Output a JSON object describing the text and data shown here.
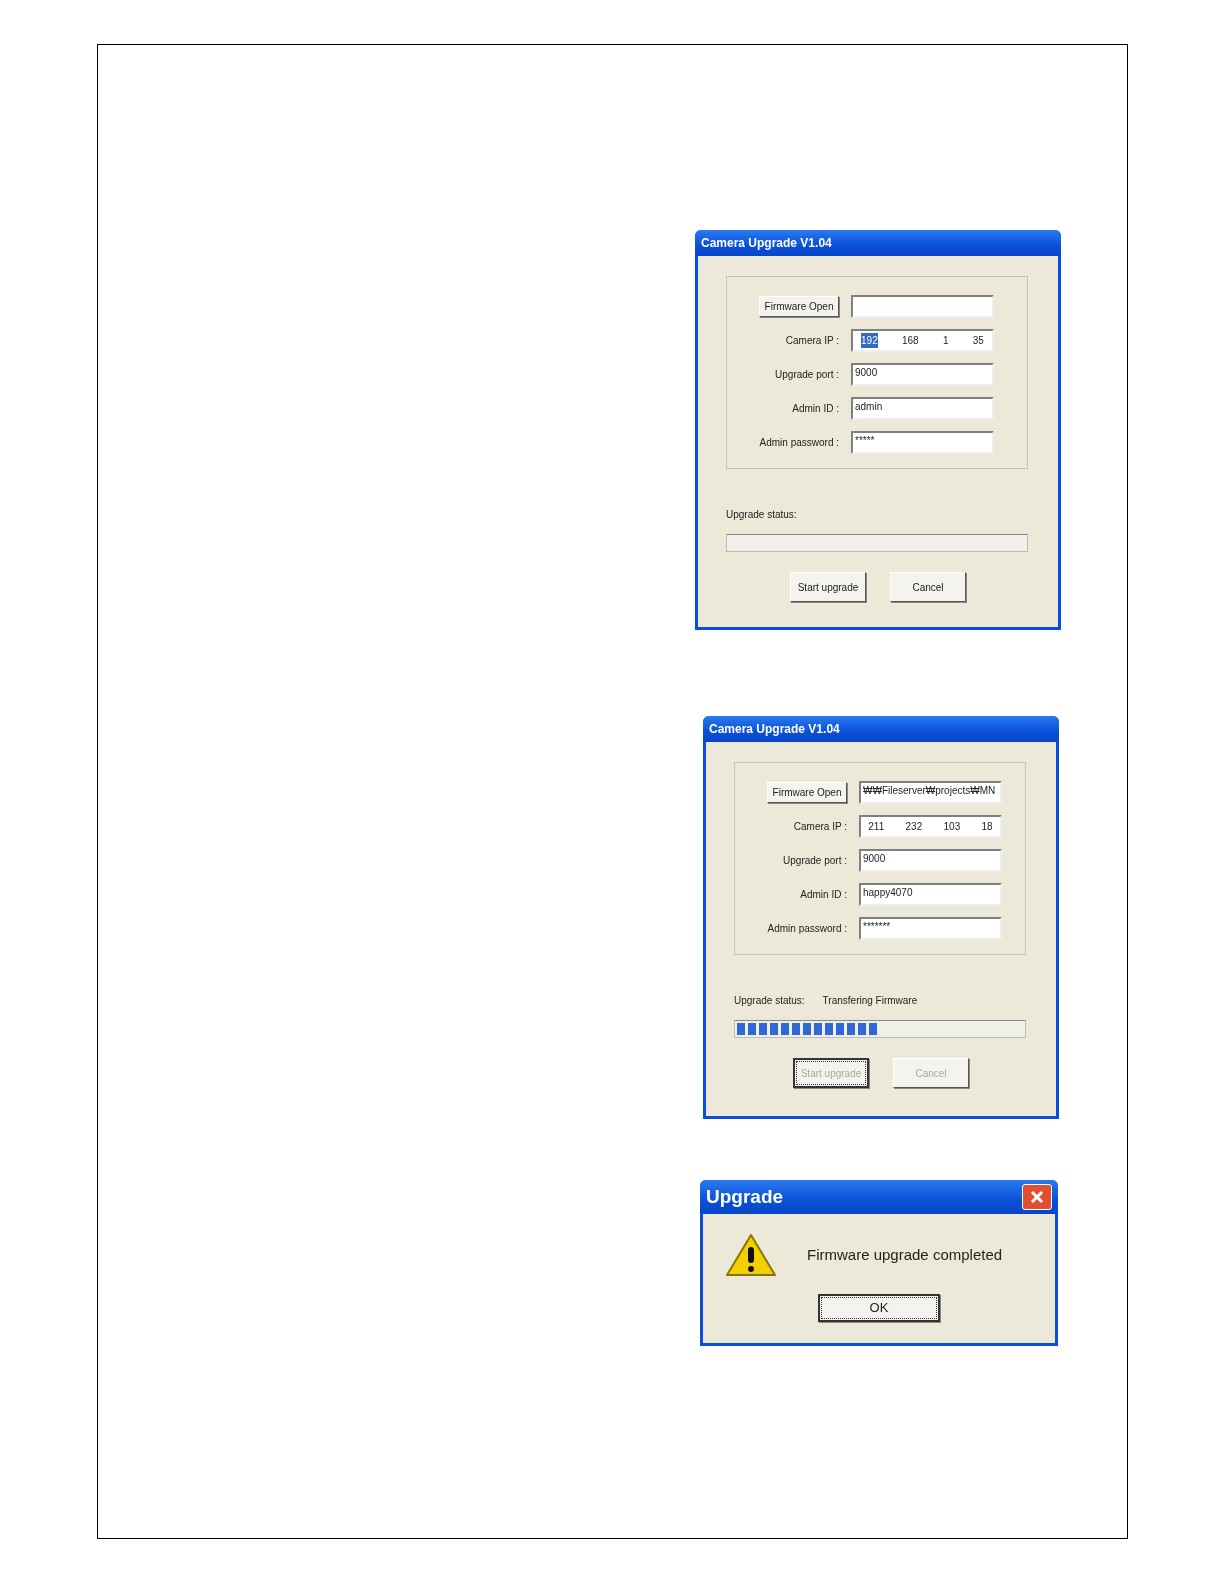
{
  "dialogs": [
    {
      "kind": "form",
      "title": "Camera Upgrade V1.04",
      "firmware_button": "Firmware Open",
      "fields": [
        {
          "kind": "ip",
          "label": "Camera IP :",
          "octets": [
            {
              "text": "192",
              "selected": true
            },
            {
              "text": "168",
              "selected": false
            },
            {
              "text": "1",
              "selected": false
            },
            {
              "text": "35",
              "selected": false
            }
          ]
        },
        {
          "kind": "text",
          "label": "Upgrade port :",
          "value": "9000"
        },
        {
          "kind": "text",
          "label": "Admin ID :",
          "value": "admin"
        },
        {
          "kind": "text",
          "label": "Admin password :",
          "value": "*****"
        }
      ],
      "status_label": "Upgrade status:",
      "buttons": [
        {
          "label": "Start upgrade",
          "disabled": false,
          "focused": false
        },
        {
          "label": "Cancel",
          "disabled": false,
          "focused": false
        }
      ]
    },
    {
      "kind": "form",
      "title": "Camera Upgrade V1.04",
      "firmware_button": "Firmware Open",
      "firmware_path": "₩₩Fileserver₩projects₩MN",
      "fields": [
        {
          "kind": "ip",
          "label": "Camera IP :",
          "octets": [
            {
              "text": "211",
              "selected": false
            },
            {
              "text": "232",
              "selected": false
            },
            {
              "text": "103",
              "selected": false
            },
            {
              "text": "18",
              "selected": false
            }
          ]
        },
        {
          "kind": "text",
          "label": "Upgrade port :",
          "value": "9000"
        },
        {
          "kind": "text",
          "label": "Admin ID :",
          "value": "happy4070"
        },
        {
          "kind": "text",
          "label": "Admin password :",
          "value": "*******"
        }
      ],
      "status_label": "Upgrade status:",
      "status_text": "Transfering Firmware",
      "progress": {
        "level": 0.5
      },
      "buttons": [
        {
          "label": "Start upgrade",
          "disabled": true,
          "focused": true
        },
        {
          "label": "Cancel",
          "disabled": true,
          "focused": false
        }
      ]
    },
    {
      "kind": "message",
      "title": "Upgrade",
      "message": "Firmware upgrade completed",
      "buttons": [
        {
          "label": "OK",
          "disabled": false,
          "focused": true
        }
      ]
    }
  ]
}
